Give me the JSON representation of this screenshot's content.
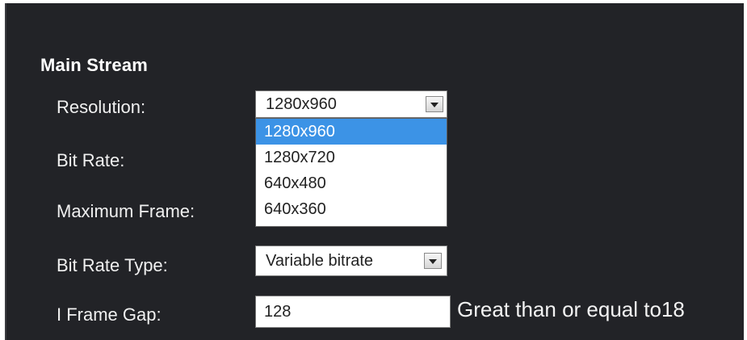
{
  "section": {
    "title": "Main Stream"
  },
  "fields": {
    "resolution_label": "Resolution:",
    "bit_rate_label": "Bit Rate:",
    "max_frame_label": "Maximum Frame:",
    "bit_rate_type_label": "Bit Rate Type:",
    "i_frame_gap_label": "I Frame Gap:"
  },
  "resolution": {
    "selected": "1280x960",
    "options": [
      "1280x960",
      "1280x720",
      "640x480",
      "640x360"
    ],
    "dropdown_open": true
  },
  "bit_rate_type": {
    "selected": "Variable bitrate"
  },
  "i_frame_gap": {
    "value": "128",
    "hint": "Great than or equal to18"
  },
  "icons": {
    "dropdown_arrow": "chevron-down-icon"
  },
  "colors": {
    "panel_background": "#222327",
    "selection_highlight": "#3c93e6"
  }
}
